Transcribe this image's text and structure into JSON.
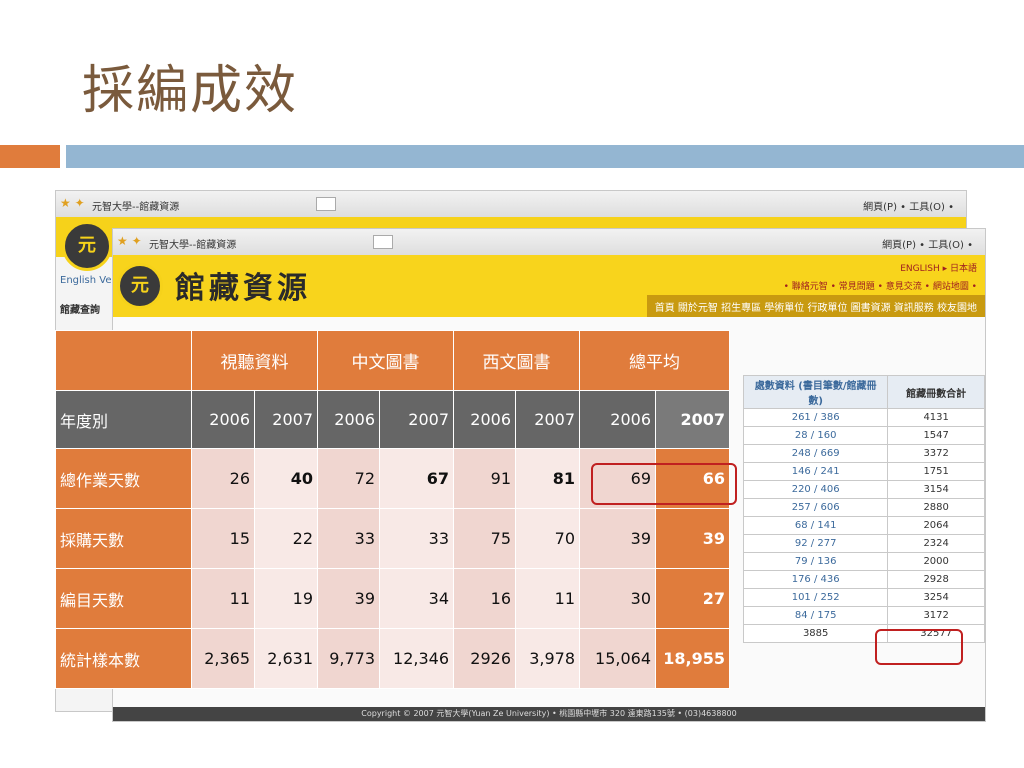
{
  "title": "採編成效",
  "colors": {
    "accent": "#e07c3c",
    "bar": "#94b6d2",
    "row_label": "#e07c3c",
    "year_row": "#666666",
    "highlight_box": "#c02020"
  },
  "screenshot_bg": {
    "browser_tab_1": "元智大學--館藏資源",
    "browser_tab_2": "元智大學--館藏資源",
    "browser_tools": "網頁(P) • 工具(O) •",
    "site_title": "館藏資源",
    "logo_char": "元",
    "lang_links": "ENGLISH ▸ 日本語",
    "top_links": "• 聯絡元智 • 常見問題 • 意見交流 • 網站地圖 •",
    "nav": "首頁  關於元智  招生專區  學術單位  行政單位  圖書資源  資訊服務  校友園地",
    "english_version": "English Ver",
    "side_tab": "館藏查詢",
    "right_table": {
      "headers": [
        "處數資料 (書目筆數/館藏冊數)",
        "館藏冊數合計"
      ],
      "rows": [
        [
          "261 / 386",
          "4131"
        ],
        [
          "28 / 160",
          "1547"
        ],
        [
          "248 / 669",
          "3372"
        ],
        [
          "146 / 241",
          "1751"
        ],
        [
          "220 / 406",
          "3154"
        ],
        [
          "257 / 606",
          "2880"
        ],
        [
          "68 / 141",
          "2064"
        ],
        [
          "92 / 277",
          "2324"
        ],
        [
          "79 / 136",
          "2000"
        ],
        [
          "176 / 436",
          "2928"
        ],
        [
          "101 / 252",
          "3254"
        ],
        [
          "84 / 175",
          "3172"
        ],
        [
          "3885",
          "32577"
        ]
      ]
    },
    "footer": "Copyright © 2007 元智大學(Yuan Ze University) • 桃園縣中壢市 320 遠東路135號 • (03)4638800"
  },
  "table": {
    "groups": [
      "視聽資料",
      "中文圖書",
      "西文圖書",
      "總平均"
    ],
    "year_label": "年度別",
    "years": [
      "2006",
      "2007",
      "2006",
      "2007",
      "2006",
      "2007",
      "2006",
      "2007"
    ],
    "rows": [
      {
        "label": "總作業天數",
        "values": [
          "26",
          "40",
          "72",
          "67",
          "91",
          "81",
          "69",
          "66"
        ]
      },
      {
        "label": "採購天數",
        "values": [
          "15",
          "22",
          "33",
          "33",
          "75",
          "70",
          "39",
          "39"
        ]
      },
      {
        "label": "編目天數",
        "values": [
          "11",
          "19",
          "39",
          "34",
          "16",
          "11",
          "30",
          "27"
        ]
      },
      {
        "label": "統計樣本數",
        "values": [
          "2,365",
          "2,631",
          "9,773",
          "12,346",
          "2926",
          "3,978",
          "15,064",
          "18,955"
        ]
      }
    ]
  }
}
